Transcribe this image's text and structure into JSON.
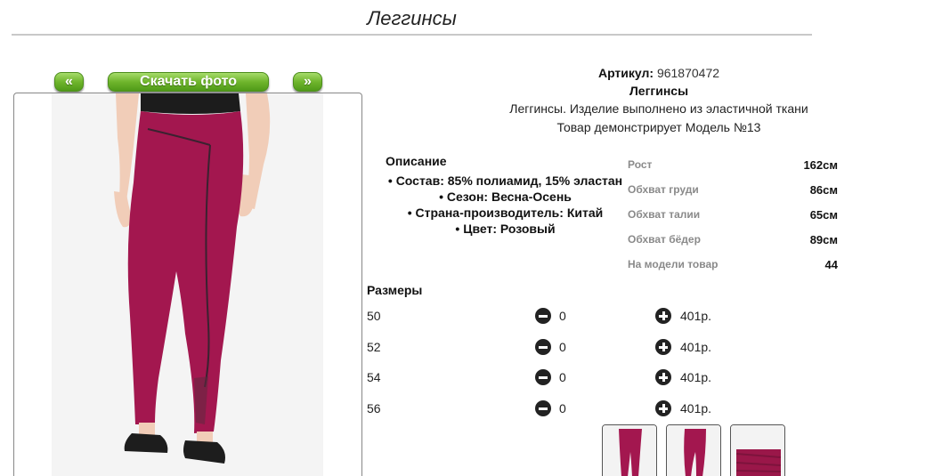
{
  "page": {
    "title": "Леггинсы"
  },
  "nav": {
    "prev_label": "«",
    "download_label": "Скачать фото",
    "next_label": "»"
  },
  "product": {
    "article_label": "Артикул:",
    "article_value": "961870472",
    "name": "Леггинсы",
    "subtitle": "Леггинсы. Изделие выполнено из эластичной ткани",
    "model_note": "Товар демонстрирует Модель №13"
  },
  "description": {
    "heading": "Описание",
    "items": [
      "Состав: 85% полиамид, 15% эластан",
      "Сезон: Весна-Осень",
      "Страна-производитель: Китай",
      "Цвет: Розовый"
    ]
  },
  "model_params": [
    {
      "label": "Рост",
      "value": "162см"
    },
    {
      "label": "Обхват груди",
      "value": "86см"
    },
    {
      "label": "Обхват талии",
      "value": "65см"
    },
    {
      "label": "Обхват бёдер",
      "value": "89см"
    },
    {
      "label": "На модели товар",
      "value": "44"
    }
  ],
  "sizes": {
    "heading": "Размеры",
    "rows": [
      {
        "size": "50",
        "qty": "0",
        "price": "401р."
      },
      {
        "size": "52",
        "qty": "0",
        "price": "401р."
      },
      {
        "size": "54",
        "qty": "0",
        "price": "401р."
      },
      {
        "size": "56",
        "qty": "0",
        "price": "401р."
      }
    ]
  },
  "colors": {
    "accent_green": "#6fb52c",
    "leggings": "#a3174f",
    "border": "#777777"
  }
}
